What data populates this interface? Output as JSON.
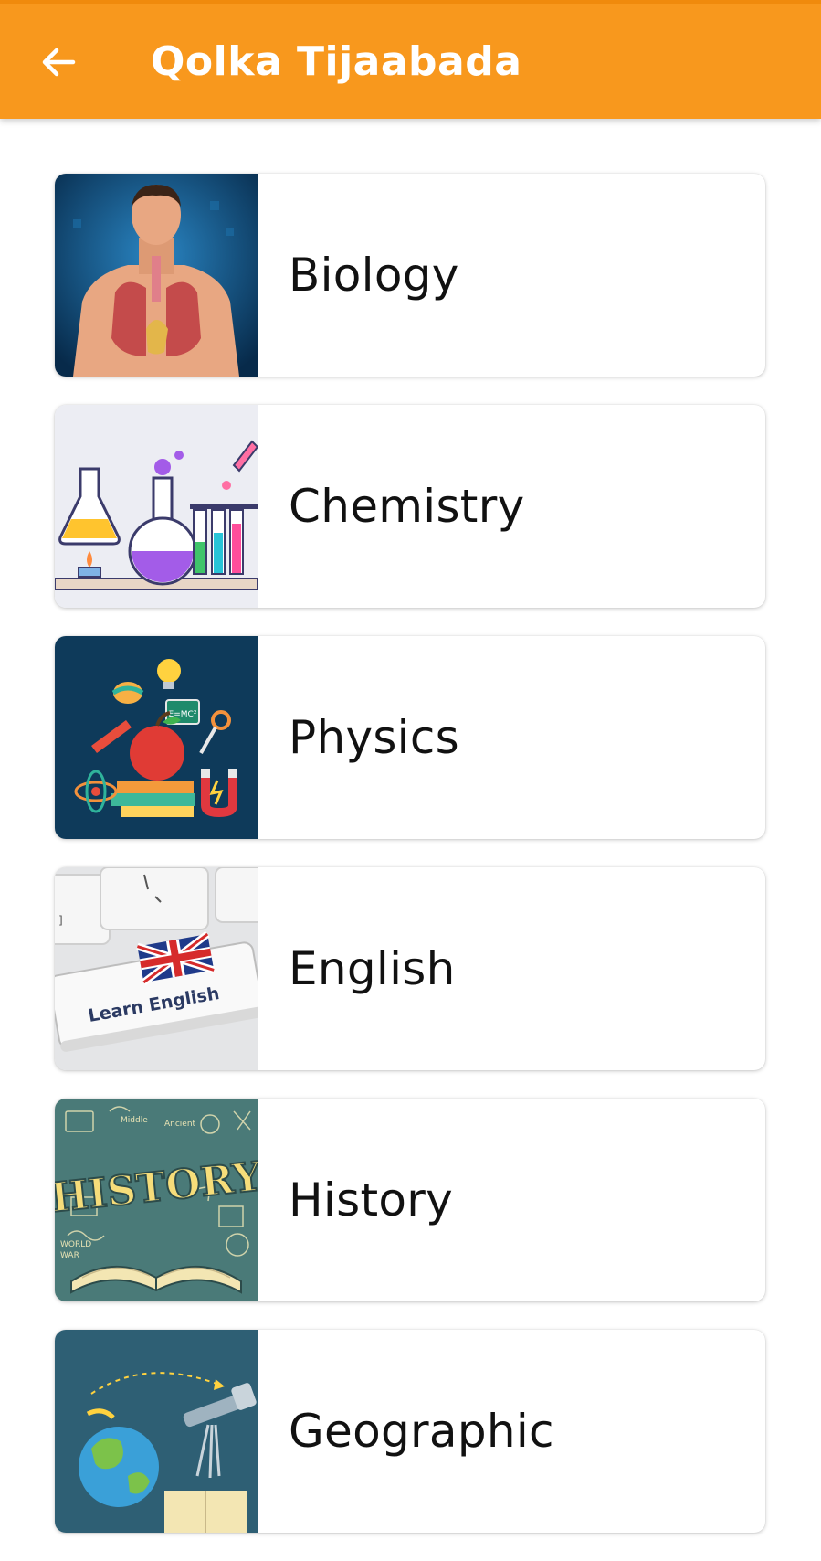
{
  "header": {
    "title": "Qolka Tijaabada",
    "back_icon": "arrow-left-icon",
    "background_color": "#f8981d"
  },
  "subjects": [
    {
      "label": "Biology",
      "image": "human-lungs-illustration"
    },
    {
      "label": "Chemistry",
      "image": "lab-flasks-illustration"
    },
    {
      "label": "Physics",
      "image": "science-objects-illustration"
    },
    {
      "label": "English",
      "image": "learn-english-keyboard-key",
      "image_text": "Learn English"
    },
    {
      "label": "History",
      "image": "history-book-doodle",
      "image_text": "HISTORY"
    },
    {
      "label": "Geographic",
      "image": "globe-telescope-illustration"
    }
  ]
}
